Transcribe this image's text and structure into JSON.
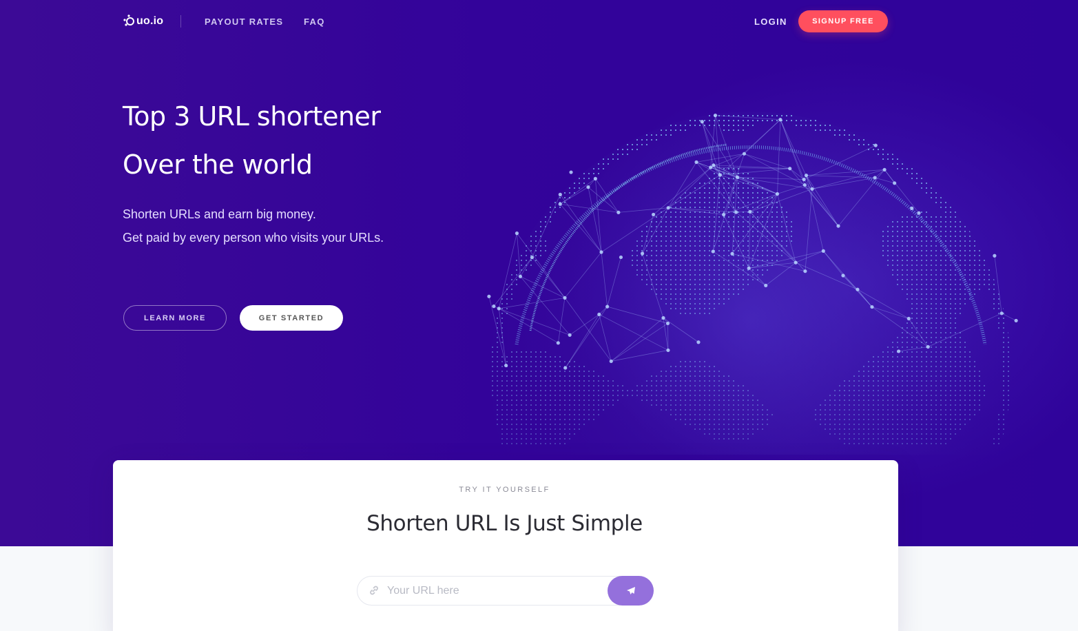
{
  "colors": {
    "hero_bg": "#33039a",
    "accent_red": "#ff4f5e",
    "accent_purple": "#9470dc",
    "globe_line": "#7fd4ff"
  },
  "nav": {
    "logo_text": "uo.io",
    "links": [
      "PAYOUT RATES",
      "FAQ"
    ],
    "login": "LOGIN",
    "signup": "SIGNUP FREE"
  },
  "hero": {
    "headline_1": "Top 3 URL shortener",
    "headline_2": "Over the world",
    "sub_1": "Shorten URLs and earn big money.",
    "sub_2": "Get paid by every person who visits your URLs.",
    "learn_more": "LEARN MORE",
    "get_started": "GET STARTED"
  },
  "shortener": {
    "eyebrow": "TRY IT YOURSELF",
    "title": "Shorten URL Is Just Simple",
    "placeholder": "Your URL here",
    "value": "",
    "link_icon": "link-icon",
    "submit_icon": "paper-plane-icon"
  }
}
